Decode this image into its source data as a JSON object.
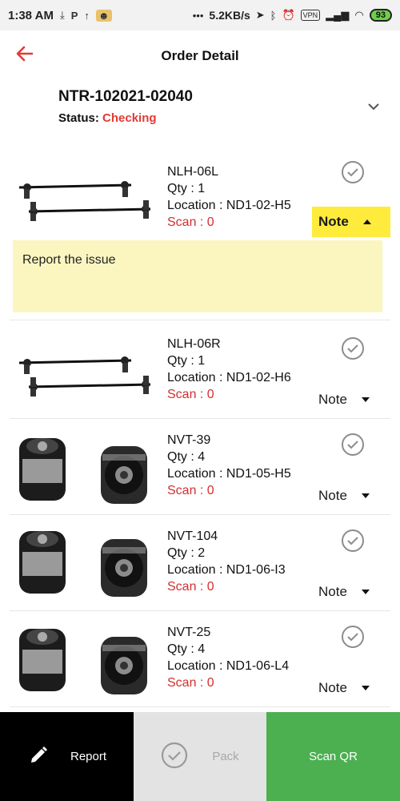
{
  "status_bar": {
    "time": "1:38 AM",
    "left_icons": [
      "download-icon",
      "parking-icon",
      "signal-arrow-icon",
      "app-notification-icon"
    ],
    "more": "•••",
    "speed": "5.2KB/s",
    "vpn": "VPN",
    "battery": "93"
  },
  "appbar": {
    "title": "Order Detail"
  },
  "order": {
    "id": "NTR-102021-02040",
    "status_label": "Status:",
    "status_value": "Checking",
    "status_color": "#e53935"
  },
  "items": [
    {
      "code": "NLH-06L",
      "qty": "Qty : 1",
      "location": "Location : ND1-02-H5",
      "scan": "Scan : 0",
      "note": "Note",
      "image": "stabilizer-link-pair"
    },
    {
      "code": "NLH-06R",
      "qty": "Qty : 1",
      "location": "Location : ND1-02-H6",
      "scan": "Scan : 0",
      "note": "Note",
      "image": "stabilizer-link-pair"
    },
    {
      "code": "NVT-39",
      "qty": "Qty : 4",
      "location": "Location : ND1-05-H5",
      "scan": "Scan : 0",
      "note": "Note",
      "image": "bushing-pair"
    },
    {
      "code": "NVT-104",
      "qty": "Qty : 2",
      "location": "Location : ND1-06-I3",
      "scan": "Scan : 0",
      "note": "Note",
      "image": "bushing-pair"
    },
    {
      "code": "NVT-25",
      "qty": "Qty : 4",
      "location": "Location : ND1-06-L4",
      "scan": "Scan : 0",
      "note": "Note",
      "image": "bushing-pair"
    }
  ],
  "issue": {
    "text": "Report the issue"
  },
  "bottom_bar": {
    "report": "Report",
    "pack": "Pack",
    "scan": "Scan QR"
  },
  "colors": {
    "accent_red": "#e53935",
    "note_active": "#ffeb3b",
    "issue_bg": "#fbf6c0",
    "scan_green": "#4caf50"
  }
}
